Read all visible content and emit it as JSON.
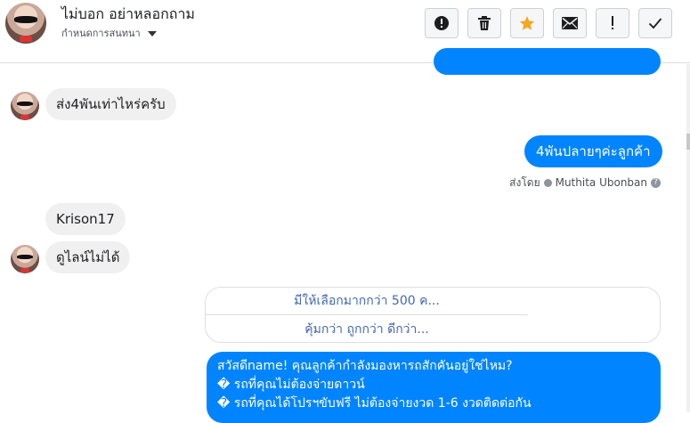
{
  "header": {
    "title": "ไม่บอก อย่าหลอกถาม",
    "subtitle": "กำหนดการสนทนา",
    "buttons": [
      {
        "name": "report-spam-button",
        "icon": "alert-circle-icon"
      },
      {
        "name": "delete-button",
        "icon": "trash-icon"
      },
      {
        "name": "star-button",
        "icon": "star-icon",
        "color": "#f5a623"
      },
      {
        "name": "mail-button",
        "icon": "envelope-icon"
      },
      {
        "name": "follow-up-button",
        "icon": "exclamation-icon"
      },
      {
        "name": "done-button",
        "icon": "checkmark-icon"
      }
    ]
  },
  "messages": {
    "in_1": "ส่ง4พันเท่าไหร่ครับ",
    "out_1": "4พันปลายๆค่ะลูกค้า",
    "sent_by_label": "ส่งโดย",
    "sent_by_name": "Muthita Ubonban",
    "sent_by_help": "?",
    "in_2": "Krison17",
    "in_3": "ดูไลน์ไม่ได้"
  },
  "card": {
    "row_1": "มีให้เลือกมากกว่า 500 ค...",
    "row_2": "คุ้มกว่า ถูกกว่า ดีกว่า..."
  },
  "promo": {
    "line_1": "สวัสดีname! คุณลูกค้ากำลังมองหารถสักคันอยู่ใช่ไหม?",
    "line_2": "� รถที่คุณไม่ต้องจ่ายดาวน์",
    "line_3": "� รถที่คุณได้โปรฯขับฟรี ไม่ต้องจ่ายงวด 1-6 งวดติดต่อกัน"
  },
  "colors": {
    "accent": "#0084ff",
    "incoming_bubble": "#f1f0f0",
    "link": "#4267b2",
    "star": "#f5a623"
  }
}
